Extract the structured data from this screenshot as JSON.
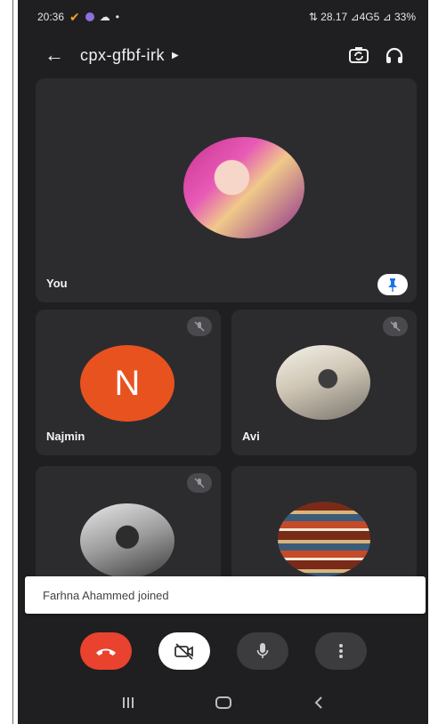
{
  "status": {
    "time": "20:36",
    "right": "⇅ 28.17 ⊿4G5 ⊿ 33%"
  },
  "meeting": {
    "code": "cpx-gfbf-irk"
  },
  "participants": [
    {
      "name": "You",
      "initial": ""
    },
    {
      "name": "Najmin",
      "initial": "N"
    },
    {
      "name": "Avi",
      "initial": ""
    },
    {
      "name": "",
      "initial": ""
    },
    {
      "name": "",
      "initial": ""
    }
  ],
  "toast": {
    "message": "Farhna Ahammed joined"
  },
  "colors": {
    "end_call": "#e9422e",
    "avatar_n": "#e8521f",
    "tile_bg": "#2c2c2f",
    "screen_bg": "#1f1f21"
  },
  "icons": [
    "back-arrow-icon",
    "switch-camera-icon",
    "headphones-icon",
    "pin-icon",
    "muted-mic-icon",
    "end-call-icon",
    "camera-off-icon",
    "mic-icon",
    "more-vert-icon",
    "recents-icon",
    "home-icon",
    "back-nav-icon"
  ]
}
